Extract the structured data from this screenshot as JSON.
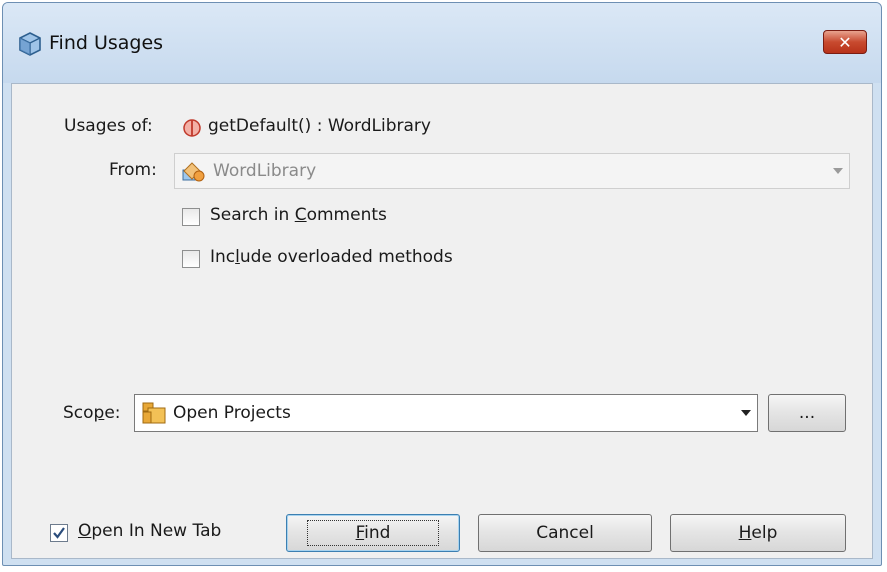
{
  "window": {
    "title": "Find Usages",
    "close_symbol": "✕"
  },
  "usages": {
    "label": "Usages of:",
    "value": "getDefault() : WordLibrary",
    "icon": "method-icon"
  },
  "from": {
    "label": "From:",
    "value": "WordLibrary",
    "icon": "class-icon",
    "enabled": false
  },
  "options": {
    "search_comments": {
      "prefix": "Search in ",
      "mnemonic": "C",
      "rest": "omments",
      "checked": false
    },
    "include_overloaded": {
      "prefix": "Inc",
      "mnemonic": "l",
      "rest": "ude overloaded methods",
      "checked": false
    }
  },
  "scope": {
    "label_prefix": "Sco",
    "label_mnemonic": "p",
    "label_rest": "e:",
    "value": "Open Projects",
    "icon": "projects-folder-icon",
    "browse_label": "..."
  },
  "footer": {
    "open_new_tab": {
      "mnemonic": "O",
      "rest": "pen In New Tab",
      "checked": true
    },
    "find": {
      "mnemonic": "F",
      "rest": "ind"
    },
    "cancel": {
      "label": "Cancel"
    },
    "help": {
      "mnemonic": "H",
      "rest": "elp"
    }
  },
  "colors": {
    "title_bar": "#c6d9ee",
    "close_button": "#c84a2f",
    "dialog_bg": "#f0f0f0",
    "default_button_border": "#3c7fb1"
  }
}
